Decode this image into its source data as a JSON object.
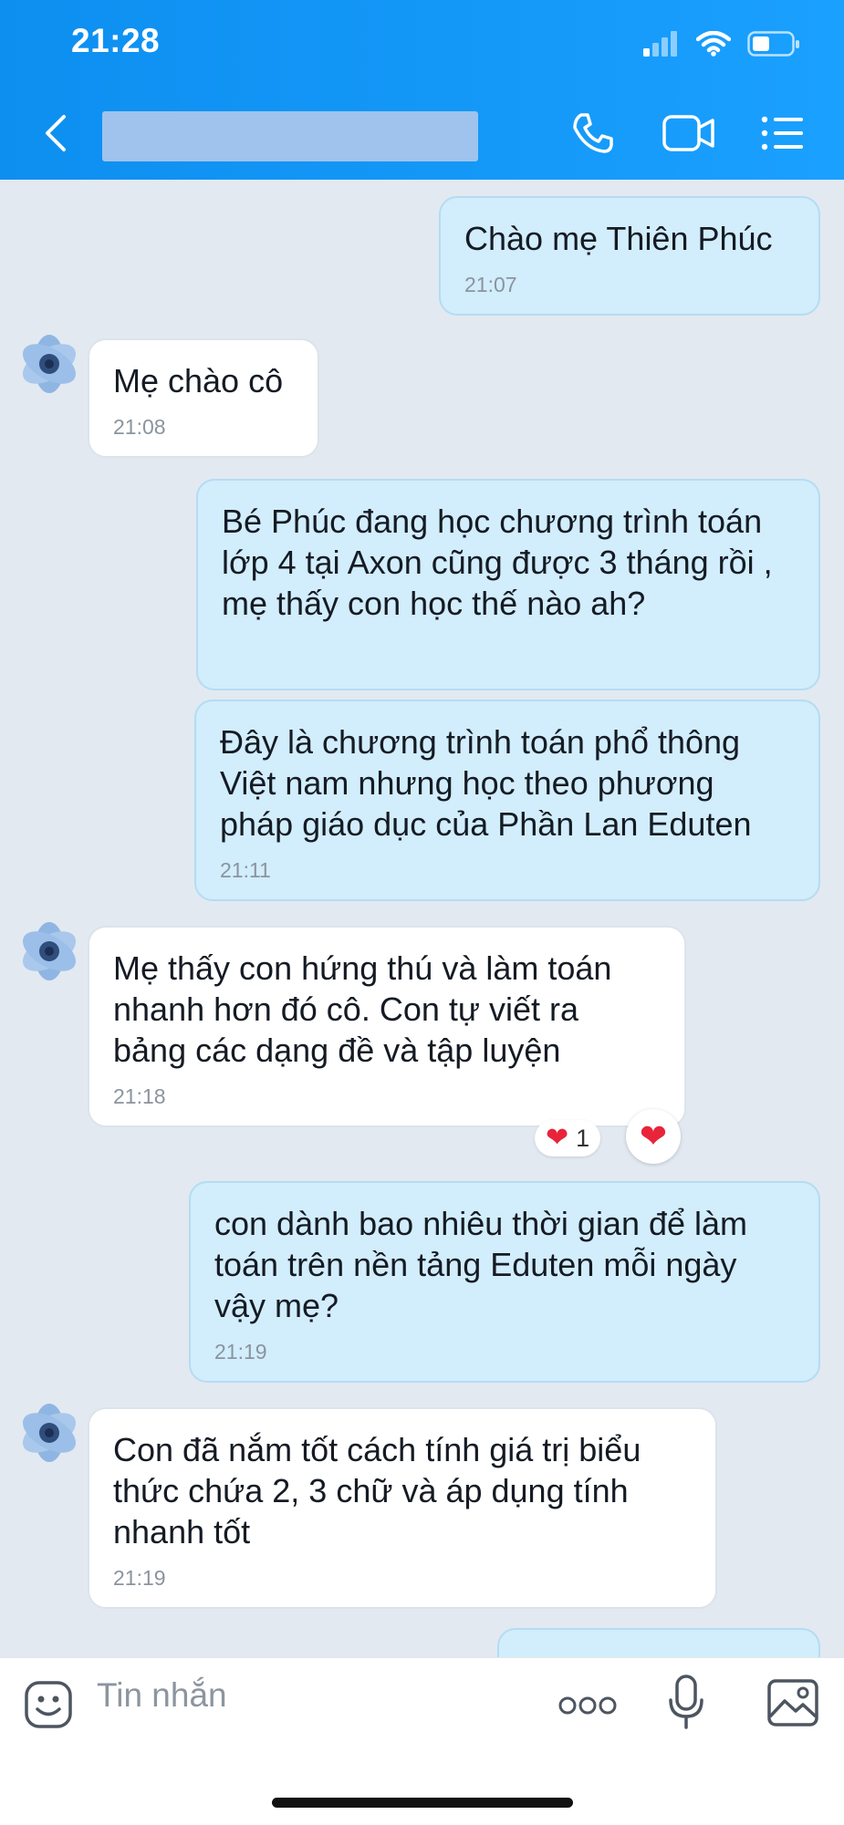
{
  "status_bar": {
    "time": "21:28"
  },
  "messages": [
    {
      "dir": "out",
      "text": "Chào mẹ Thiên Phúc",
      "time": "21:07"
    },
    {
      "dir": "in",
      "text": "Mẹ chào cô",
      "time": "21:08"
    },
    {
      "dir": "out",
      "text": "Bé Phúc đang học chương trình toán lớp 4 tại Axon cũng được 3 tháng rồi , mẹ thấy con học thế nào ah?",
      "time": ""
    },
    {
      "dir": "out",
      "text": "Đây là chương trình toán phổ thông Việt nam nhưng học theo phương pháp giáo dục của Phần Lan Eduten",
      "time": "21:11"
    },
    {
      "dir": "in",
      "text": "Mẹ thấy con hứng thú và làm toán nhanh hơn đó cô. Con tự viết ra bảng các dạng đề và tập luyện",
      "time": "21:18"
    },
    {
      "dir": "out",
      "text": "con dành bao nhiêu thời gian để làm toán trên nền tảng Eduten mỗi ngày vậy mẹ?",
      "time": "21:19"
    },
    {
      "dir": "in",
      "text": "Con đã nắm tốt cách tính giá trị biểu thức chứa 2, 3 chữ và áp dụng  tính nhanh tốt",
      "time": "21:19"
    }
  ],
  "reaction": {
    "emoji": "❤",
    "count": "1"
  },
  "input": {
    "placeholder": "Tin nhắn"
  },
  "colors": {
    "header": "#1296f5",
    "outgoing_bubble": "#d2edfc",
    "incoming_bubble": "#ffffff",
    "background": "#e2e9f1"
  },
  "icons": [
    "back-icon",
    "phone-icon",
    "video-call-icon",
    "menu-list-icon",
    "sticker-icon",
    "more-icon",
    "microphone-icon",
    "image-icon"
  ]
}
